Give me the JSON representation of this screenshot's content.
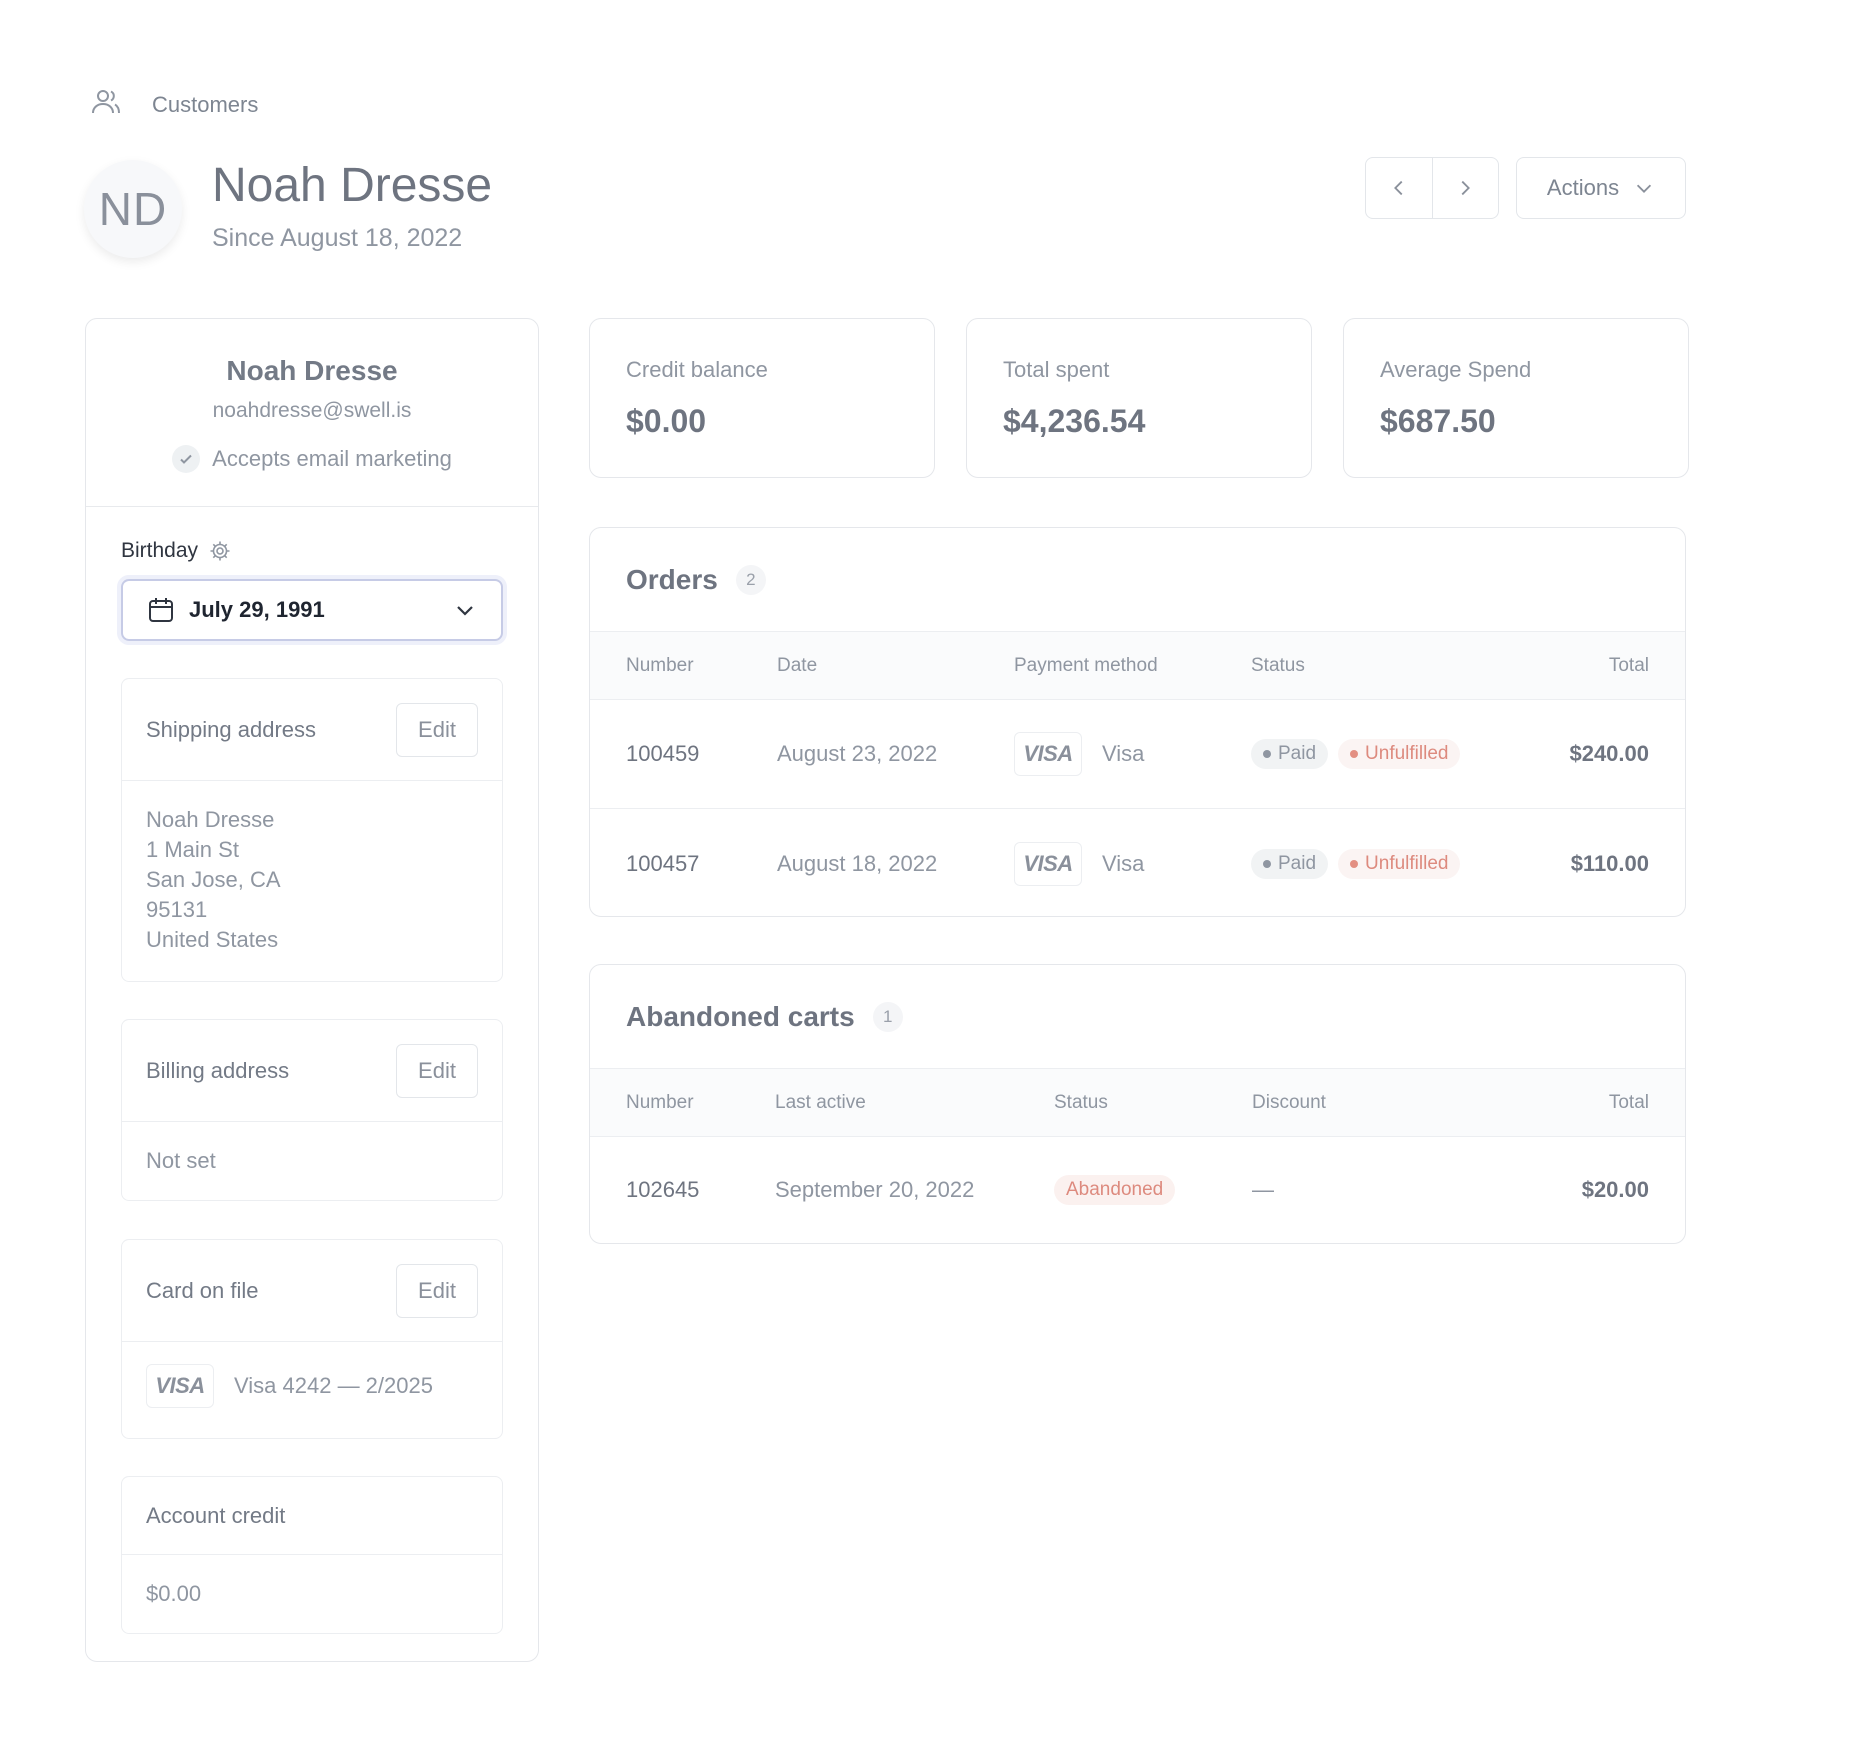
{
  "breadcrumb": {
    "label": "Customers",
    "icon": "users-icon"
  },
  "header": {
    "initials": "ND",
    "name": "Noah Dresse",
    "since": "Since August 18, 2022",
    "actions_label": "Actions"
  },
  "profile": {
    "name": "Noah Dresse",
    "email": "noahdresse@swell.is",
    "marketing": "Accepts email marketing",
    "birthday_label": "Birthday",
    "birthday_value": "July 29, 1991"
  },
  "shipping": {
    "title": "Shipping address",
    "edit_label": "Edit",
    "lines": [
      "Noah Dresse",
      "1 Main St",
      "San Jose, CA",
      "95131",
      "United States"
    ]
  },
  "billing": {
    "title": "Billing address",
    "edit_label": "Edit",
    "value": "Not set"
  },
  "card": {
    "title": "Card on file",
    "edit_label": "Edit",
    "brand": "VISA",
    "value": "Visa 4242 — 2/2025"
  },
  "account_credit": {
    "title": "Account credit",
    "value": "$0.00"
  },
  "stats": [
    {
      "label": "Credit balance",
      "value": "$0.00"
    },
    {
      "label": "Total spent",
      "value": "$4,236.54"
    },
    {
      "label": "Average Spend",
      "value": "$687.50"
    }
  ],
  "orders": {
    "title": "Orders",
    "count": "2",
    "columns": [
      "Number",
      "Date",
      "Payment method",
      "Status",
      "Total"
    ],
    "rows": [
      {
        "number": "100459",
        "date": "August 23, 2022",
        "brand": "VISA",
        "method": "Visa",
        "paid": "Paid",
        "fulfillment": "Unfulfilled",
        "total": "$240.00"
      },
      {
        "number": "100457",
        "date": "August 18, 2022",
        "brand": "VISA",
        "method": "Visa",
        "paid": "Paid",
        "fulfillment": "Unfulfilled",
        "total": "$110.00"
      }
    ]
  },
  "carts": {
    "title": "Abandoned carts",
    "count": "1",
    "columns": [
      "Number",
      "Last active",
      "Status",
      "Discount",
      "Total"
    ],
    "rows": [
      {
        "number": "102645",
        "last_active": "September 20, 2022",
        "status": "Abandoned",
        "discount": "—",
        "total": "$20.00"
      }
    ]
  },
  "colors": {
    "text": "#6e7480",
    "muted": "#8f96a1",
    "border": "#e5e7eb",
    "unfulfilled": "#dd8a7e"
  }
}
